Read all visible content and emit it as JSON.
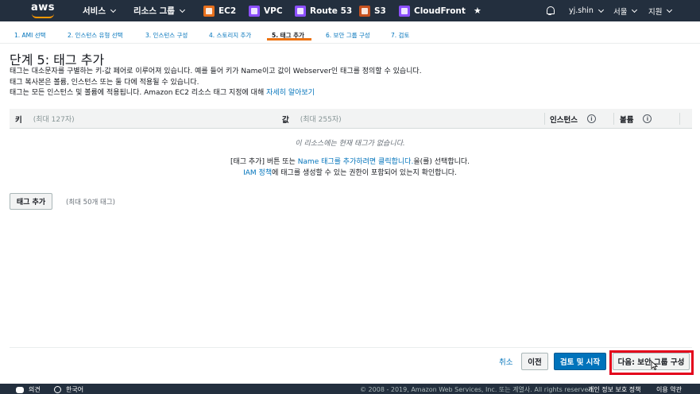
{
  "nav": {
    "logo": "aws",
    "services": "서비스",
    "resource_groups": "리소스 그룹",
    "shortcuts": [
      {
        "label": "EC2",
        "icon": "ec2-icon",
        "color": "#e7701d"
      },
      {
        "label": "VPC",
        "icon": "vpc-icon",
        "color": "#8c4fff"
      },
      {
        "label": "Route 53",
        "icon": "route53-icon",
        "color": "#8c4fff"
      },
      {
        "label": "S3",
        "icon": "s3-icon",
        "color": "#c7511f"
      },
      {
        "label": "CloudFront",
        "icon": "cloudfront-icon",
        "color": "#8c4fff"
      }
    ],
    "user": "yj.shin",
    "region": "서울",
    "support": "지원"
  },
  "steps": [
    {
      "label": "1. AMI 선택"
    },
    {
      "label": "2. 인스턴스 유형 선택"
    },
    {
      "label": "3. 인스턴스 구성"
    },
    {
      "label": "4. 스토리지 추가"
    },
    {
      "label": "5. 태그 추가",
      "active": true
    },
    {
      "label": "6. 보안 그룹 구성"
    },
    {
      "label": "7. 검토"
    }
  ],
  "page": {
    "title": "단계 5: 태그 추가",
    "desc1": "태그는 대소문자를 구별하는 키-값 페어로 이루어져 있습니다. 예를 들어 키가 Name이고 값이 Webserver인 태그를 정의할 수 있습니다.",
    "desc2": "태그 복사본은 볼륨, 인스턴스 또는 둘 다에 적용될 수 있습니다.",
    "desc3": "태그는 모든 인스턴스 및 볼륨에 적용됩니다. Amazon EC2 리소스 태그 지정에 대해",
    "desc3_link": "자세히 알아보기"
  },
  "table": {
    "key": "키",
    "key_hint": "(최대 127자)",
    "value": "값",
    "value_hint": "(최대 255자)",
    "instance": "인스턴스",
    "volume": "볼륨",
    "empty": "이 리소스에는 현재 태그가 없습니다.",
    "hint1_pre": "[태그 추가] 버튼 또는",
    "hint1_link": "Name 태그를 추가하려면 클릭합니다.",
    "hint1_post": "을(를) 선택합니다.",
    "hint2_link": "IAM 정책",
    "hint2_post": "에 태그를 생성할 수 있는 권한이 포함되어 있는지 확인합니다."
  },
  "add_tag": {
    "label": "태그 추가",
    "hint": "(최대 50개 태그)"
  },
  "footer": {
    "cancel": "취소",
    "prev": "이전",
    "review": "검토 및 시작",
    "next": "다음: 보안 그룹 구성"
  },
  "bottom": {
    "feedback": "의견",
    "language": "한국어",
    "copyright": "© 2008 - 2019, Amazon Web Services, Inc. 또는 계열사. All rights reserved.",
    "privacy": "개인 정보 보호 정책",
    "terms": "이용 약관"
  }
}
